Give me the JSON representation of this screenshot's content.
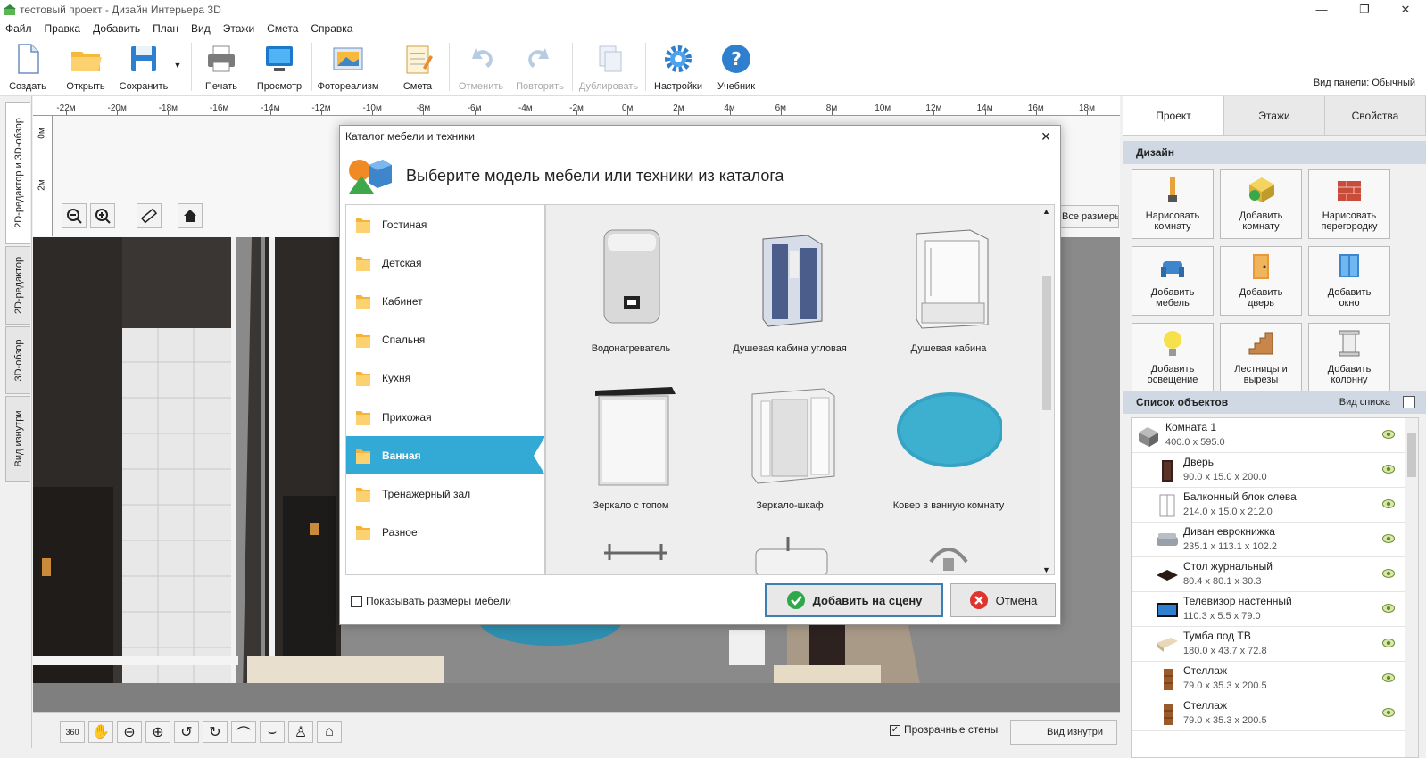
{
  "window": {
    "title": "тестовый проект - Дизайн Интерьера 3D",
    "minimize": "—",
    "maximize": "❐",
    "close": "✕"
  },
  "menu": [
    "Файл",
    "Правка",
    "Добавить",
    "План",
    "Вид",
    "Этажи",
    "Смета",
    "Справка"
  ],
  "toolbar": {
    "create": "Создать",
    "open": "Открыть",
    "save": "Сохранить",
    "print": "Печать",
    "preview": "Просмотр",
    "photorealism": "Фотореализм",
    "estimate": "Смета",
    "undo": "Отменить",
    "redo": "Повторить",
    "duplicate": "Дублировать",
    "settings": "Настройки",
    "tutorial": "Учебник",
    "panel_view_label": "Вид панели:",
    "panel_view_value": "Обычный"
  },
  "left_tabs": [
    "2D-редактор и 3D-обзор",
    "2D-редактор",
    "3D-обзор",
    "Вид изнутри"
  ],
  "ruler": {
    "h_ticks": [
      "-22м",
      "-20м",
      "-18м",
      "-16м",
      "-14м",
      "-12м",
      "-10м",
      "-8м",
      "-6м",
      "-4м",
      "-2м",
      "0м",
      "2м",
      "4м",
      "6м",
      "8м",
      "10м",
      "12м",
      "14м",
      "16м",
      "18м"
    ],
    "v_ticks": [
      "0м",
      "2м"
    ]
  },
  "editor": {
    "all_sizes": "Все размеры",
    "transparent_walls": "Прозрачные стены",
    "view_inside": "Вид изнутри"
  },
  "right_panel": {
    "tabs": [
      "Проект",
      "Этажи",
      "Свойства"
    ],
    "design_header": "Дизайн",
    "design_buttons": [
      {
        "line1": "Нарисовать",
        "line2": "комнату",
        "icon": "brush-icon"
      },
      {
        "line1": "Добавить",
        "line2": "комнату",
        "icon": "add-room-icon"
      },
      {
        "line1": "Нарисовать",
        "line2": "перегородку",
        "icon": "brick-wall-icon"
      },
      {
        "line1": "Добавить",
        "line2": "мебель",
        "icon": "armchair-icon"
      },
      {
        "line1": "Добавить",
        "line2": "дверь",
        "icon": "door-icon"
      },
      {
        "line1": "Добавить",
        "line2": "окно",
        "icon": "window-icon"
      },
      {
        "line1": "Добавить",
        "line2": "освещение",
        "icon": "lightbulb-icon"
      },
      {
        "line1": "Лестницы и",
        "line2": "вырезы",
        "icon": "stairs-icon"
      },
      {
        "line1": "Добавить",
        "line2": "колонну",
        "icon": "column-icon"
      }
    ],
    "objects_header": "Список объектов",
    "list_view": "Вид списка",
    "objects": [
      {
        "name": "Комната 1",
        "dims": "400.0 x 595.0",
        "icon": "room-icon",
        "root": true
      },
      {
        "name": "Дверь",
        "dims": "90.0 x 15.0 x 200.0",
        "icon": "door-icon"
      },
      {
        "name": "Балконный блок слева",
        "dims": "214.0 x 15.0 x 212.0",
        "icon": "balcony-door-icon"
      },
      {
        "name": "Диван еврокнижка",
        "dims": "235.1 x 113.1 x 102.2",
        "icon": "sofa-icon"
      },
      {
        "name": "Стол журнальный",
        "dims": "80.4 x 80.1 x 30.3",
        "icon": "coffee-table-icon"
      },
      {
        "name": "Телевизор настенный",
        "dims": "110.3 x 5.5 x 79.0",
        "icon": "tv-icon"
      },
      {
        "name": "Тумба под ТВ",
        "dims": "180.0 x 43.7 x 72.8",
        "icon": "tv-stand-icon"
      },
      {
        "name": "Стеллаж",
        "dims": "79.0 x 35.3 x 200.5",
        "icon": "shelf-icon"
      },
      {
        "name": "Стеллаж",
        "dims": "79.0 x 35.3 x 200.5",
        "icon": "shelf-icon"
      }
    ]
  },
  "dialog": {
    "title": "Каталог мебели и техники",
    "heading": "Выберите модель мебели или техники из каталога",
    "categories": [
      "Гостиная",
      "Детская",
      "Кабинет",
      "Спальня",
      "Кухня",
      "Прихожая",
      "Ванная",
      "Тренажерный зал",
      "Разное"
    ],
    "active_category": "Ванная",
    "items": [
      {
        "name": "Водонагреватель",
        "icon": "water-heater-icon"
      },
      {
        "name": "Душевая кабина угловая",
        "icon": "corner-shower-icon"
      },
      {
        "name": "Душевая кабина",
        "icon": "shower-cabin-icon"
      },
      {
        "name": "Зеркало с топом",
        "icon": "mirror-top-icon"
      },
      {
        "name": "Зеркало-шкаф",
        "icon": "mirror-cabinet-icon"
      },
      {
        "name": "Ковер в ванную комнату",
        "icon": "bath-rug-icon"
      }
    ],
    "show_sizes": "Показывать размеры мебели",
    "add_button": "Добавить на сцену",
    "cancel_button": "Отмена"
  },
  "colors": {
    "accent": "#33aad6",
    "section_header": "#cfd8e3",
    "add_border": "#3c7fb1"
  }
}
